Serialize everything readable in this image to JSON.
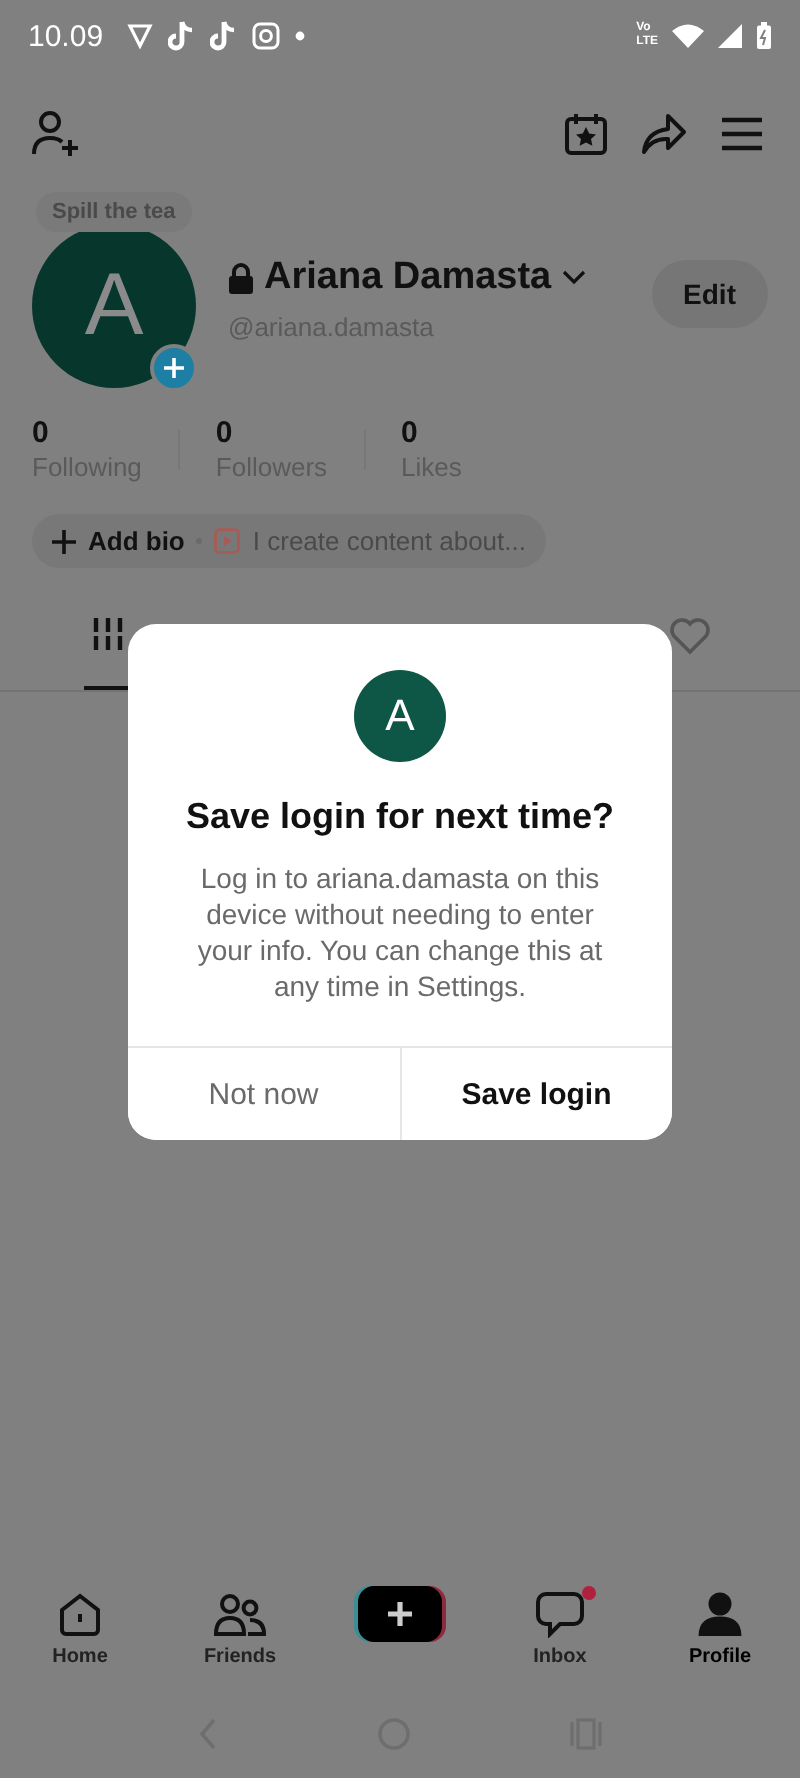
{
  "status_bar": {
    "time": "10.09",
    "network_top": "Vo",
    "network_bottom": "LTE"
  },
  "profile": {
    "bubble": "Spill the tea",
    "avatar_letter": "A",
    "name": "Ariana Damasta",
    "handle": "@ariana.damasta",
    "edit": "Edit",
    "locked": true
  },
  "stats": [
    {
      "value": "0",
      "label": "Following"
    },
    {
      "value": "0",
      "label": "Followers"
    },
    {
      "value": "0",
      "label": "Likes"
    }
  ],
  "bio": {
    "add": "Add bio",
    "hint": "I create content about..."
  },
  "tabs": [
    {
      "kind": "grid",
      "selected": true
    },
    {
      "kind": "liked",
      "selected": false
    }
  ],
  "dialog": {
    "avatar_letter": "A",
    "title": "Save login for next time?",
    "message": "Log in to ariana.damasta on this device without needing to enter your info. You can change this at any time in Settings.",
    "buttons": [
      {
        "label": "Not now",
        "primary": false
      },
      {
        "label": "Save login",
        "primary": true
      }
    ]
  },
  "nav": [
    {
      "kind": "home",
      "label": "Home",
      "selected": false,
      "badge": false
    },
    {
      "kind": "friends",
      "label": "Friends",
      "selected": false,
      "badge": false
    },
    {
      "kind": "create",
      "selected": false,
      "badge": false
    },
    {
      "kind": "inbox",
      "label": "Inbox",
      "selected": false,
      "badge": true
    },
    {
      "kind": "profile",
      "label": "Profile",
      "selected": true,
      "badge": false
    }
  ]
}
